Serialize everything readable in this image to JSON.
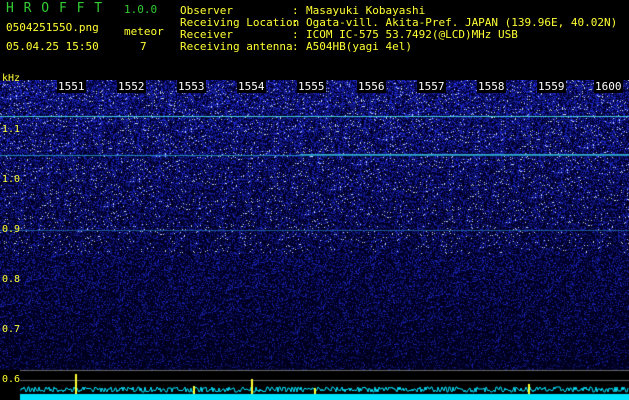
{
  "app": {
    "name": "H R O F F T",
    "version": "1.0.0"
  },
  "file": {
    "name": "050425155O.png",
    "datetime": "05.04.25 15:50"
  },
  "meteor": {
    "label": "meteor",
    "count": "7"
  },
  "info": [
    {
      "key": "Observer",
      "sep": ":",
      "value": "Masayuki Kobayashi"
    },
    {
      "key": "Receiving Location",
      "sep": ":",
      "value": "Ogata-vill. Akita-Pref. JAPAN (139.96E, 40.02N)"
    },
    {
      "key": "Receiver",
      "sep": ":",
      "value": "ICOM IC-575 53.7492(@LCD)MHz USB"
    },
    {
      "key": "Receiving antenna",
      "sep": ":",
      "value": "A504HB(yagi 4el)"
    }
  ],
  "y_axis": {
    "unit": "kHz",
    "ticks": [
      "1.1",
      "1.0",
      "0.9",
      "0.8",
      "0.7",
      "0.6"
    ]
  },
  "time_ticks": [
    "1551",
    "1552",
    "1553",
    "1554",
    "1555",
    "1556",
    "1557",
    "1558",
    "1559",
    "1600"
  ],
  "colors": {
    "background": "#000000",
    "signal": "#3355ff",
    "header_text": "#ffff33",
    "trace": "#00e5ff"
  }
}
